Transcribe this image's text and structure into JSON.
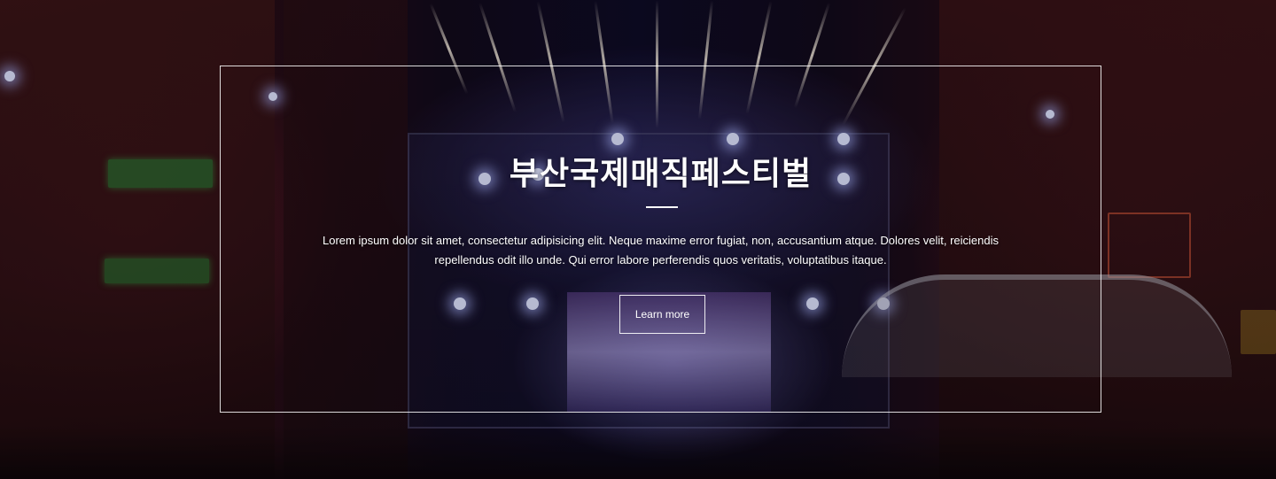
{
  "hero": {
    "title": "부산국제매직페스티벌",
    "description": "Lorem ipsum dolor sit amet, consectetur adipisicing elit. Neque maxime error fugiat, non, accusantium atque. Dolores velit, reiciendis repellendus odit illo unde. Qui error labore perferendis quos veritatis, voluptatibus itaque.",
    "button_label": "Learn more",
    "colors": {
      "text": "#ffffff",
      "frame_border": "#ffffff"
    }
  }
}
